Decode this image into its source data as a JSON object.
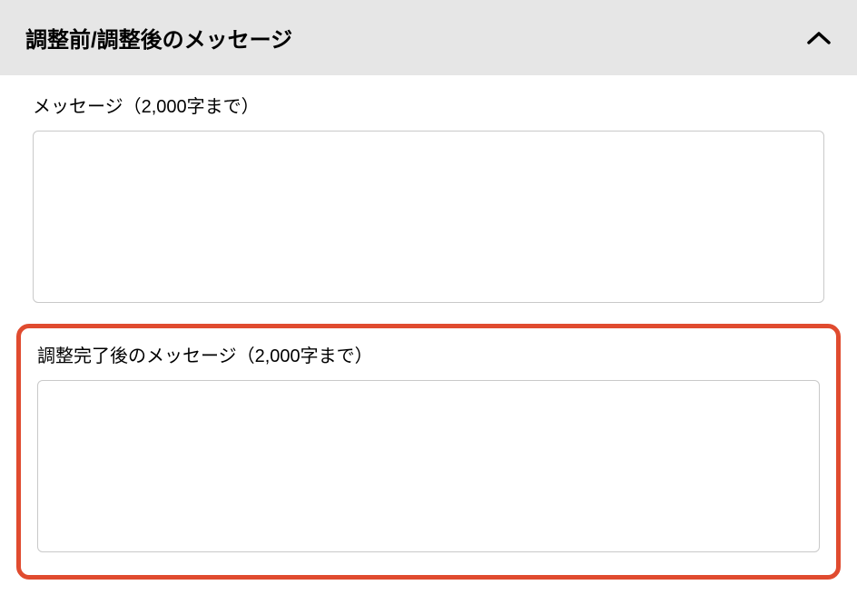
{
  "section": {
    "title": "調整前/調整後のメッセージ"
  },
  "fields": {
    "message": {
      "label": "メッセージ（2,000字まで）",
      "value": ""
    },
    "postAdjustMessage": {
      "label": "調整完了後のメッセージ（2,000字まで）",
      "value": ""
    }
  }
}
